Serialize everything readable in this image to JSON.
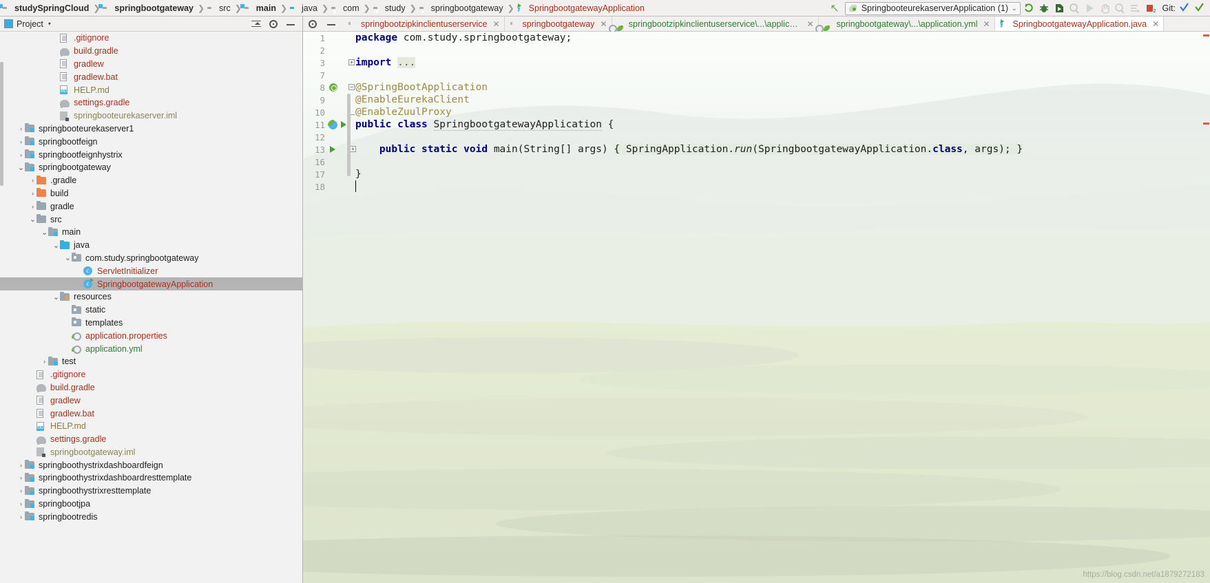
{
  "navbar": {
    "breadcrumbs": [
      {
        "label": "studySpringCloud",
        "icon": "module-icon",
        "bold": true
      },
      {
        "label": "springbootgateway",
        "icon": "module-icon",
        "bold": true
      },
      {
        "label": "src",
        "icon": "folder-icon",
        "bold": false
      },
      {
        "label": "main",
        "icon": "source-folder-icon",
        "bold": true
      },
      {
        "label": "java",
        "icon": "java-source-folder-icon",
        "bold": false
      },
      {
        "label": "com",
        "icon": "package-icon",
        "bold": false
      },
      {
        "label": "study",
        "icon": "package-icon",
        "bold": false
      },
      {
        "label": "springbootgateway",
        "icon": "package-icon",
        "bold": false
      },
      {
        "label": "SpringbootgatewayApplication",
        "icon": "spring-class-icon",
        "bold": false
      }
    ],
    "back_arrow": "navigate-back-icon",
    "run_config": {
      "label": "SpringbooteurekaserverApplication (1)",
      "icon": "spring-run-config-icon",
      "caret": "⌄"
    },
    "toolbar_buttons": [
      {
        "name": "rerun-icon",
        "glyph": "↻",
        "enabled": true,
        "color": "#4a9e2f"
      },
      {
        "name": "debug-icon",
        "glyph": "⚙",
        "enabled": true,
        "color": "#3c763d"
      },
      {
        "name": "run-with-coverage-icon",
        "glyph": "▶",
        "enabled": true,
        "color": "#2f6b2f"
      },
      {
        "name": "profile-icon",
        "glyph": "▶",
        "enabled": false,
        "color": "#888888"
      },
      {
        "name": "run-icon",
        "glyph": "▶",
        "enabled": false,
        "color": "#8fae8f"
      },
      {
        "name": "stop-icon",
        "glyph": "✋",
        "enabled": false,
        "color": "#999999"
      },
      {
        "name": "attach-debugger-icon",
        "glyph": "▶",
        "enabled": false,
        "color": "#999999"
      },
      {
        "name": "show-console-icon",
        "glyph": "≡",
        "enabled": false,
        "color": "#888888"
      },
      {
        "name": "stop-process-icon",
        "glyph": "■",
        "enabled": true,
        "color": "#d14836",
        "badge": "2"
      }
    ],
    "git_label": "Git:",
    "git_buttons": [
      {
        "name": "update-project-icon",
        "glyph": "✓",
        "color": "#3c78c8"
      },
      {
        "name": "commit-icon",
        "glyph": "✓",
        "color": "#4f9b2f"
      }
    ]
  },
  "sidebar": {
    "header": {
      "title": "Project",
      "caret": "▾",
      "actions": [
        {
          "name": "collapse-all-icon"
        },
        {
          "name": "gear-icon"
        },
        {
          "name": "hide-icon"
        }
      ]
    },
    "tree": [
      {
        "indent": 4,
        "arrow": "",
        "icon": "file-icon",
        "label": ".gitignore",
        "color": "c-red"
      },
      {
        "indent": 4,
        "arrow": "",
        "icon": "gradle-icon",
        "label": "build.gradle",
        "color": "c-red"
      },
      {
        "indent": 4,
        "arrow": "",
        "icon": "file-icon",
        "label": "gradlew",
        "color": "c-red"
      },
      {
        "indent": 4,
        "arrow": "",
        "icon": "file-icon",
        "label": "gradlew.bat",
        "color": "c-red"
      },
      {
        "indent": 4,
        "arrow": "",
        "icon": "markdown-icon",
        "label": "HELP.md",
        "color": "c-brown"
      },
      {
        "indent": 4,
        "arrow": "",
        "icon": "gradle-icon",
        "label": "settings.gradle",
        "color": "c-red"
      },
      {
        "indent": 4,
        "arrow": "",
        "icon": "iml-icon",
        "label": "springbooteurekaserver.iml",
        "color": "c-olive"
      },
      {
        "indent": 1,
        "arrow": "›",
        "icon": "module-icon",
        "label": "springbooteurekaserver1",
        "color": "c-default"
      },
      {
        "indent": 1,
        "arrow": "›",
        "icon": "module-icon",
        "label": "springbootfeign",
        "color": "c-default"
      },
      {
        "indent": 1,
        "arrow": "›",
        "icon": "module-icon",
        "label": "springbootfeignhystrix",
        "color": "c-default"
      },
      {
        "indent": 1,
        "arrow": "⌄",
        "icon": "module-icon",
        "label": "springbootgateway",
        "color": "c-default"
      },
      {
        "indent": 2,
        "arrow": "›",
        "icon": "excluded-folder-icon",
        "label": ".gradle",
        "color": "c-default"
      },
      {
        "indent": 2,
        "arrow": "›",
        "icon": "excluded-folder-icon",
        "label": "build",
        "color": "c-default"
      },
      {
        "indent": 2,
        "arrow": "›",
        "icon": "folder-icon",
        "label": "gradle",
        "color": "c-default"
      },
      {
        "indent": 2,
        "arrow": "⌄",
        "icon": "folder-icon",
        "label": "src",
        "color": "c-default"
      },
      {
        "indent": 3,
        "arrow": "⌄",
        "icon": "source-folder-icon",
        "label": "main",
        "color": "c-default"
      },
      {
        "indent": 4,
        "arrow": "⌄",
        "icon": "java-source-folder-icon",
        "label": "java",
        "color": "c-default"
      },
      {
        "indent": 5,
        "arrow": "⌄",
        "icon": "package-icon",
        "label": "com.study.springbootgateway",
        "color": "c-default"
      },
      {
        "indent": 6,
        "arrow": "",
        "icon": "class-icon",
        "label": "ServletInitializer",
        "color": "c-red"
      },
      {
        "indent": 6,
        "arrow": "",
        "icon": "spring-class-icon",
        "label": "SpringbootgatewayApplication",
        "color": "c-red",
        "selected": true
      },
      {
        "indent": 4,
        "arrow": "⌄",
        "icon": "resources-folder-icon",
        "label": "resources",
        "color": "c-default"
      },
      {
        "indent": 5,
        "arrow": "",
        "icon": "package-icon",
        "label": "static",
        "color": "c-default"
      },
      {
        "indent": 5,
        "arrow": "",
        "icon": "package-icon",
        "label": "templates",
        "color": "c-default"
      },
      {
        "indent": 5,
        "arrow": "",
        "icon": "spring-config-icon",
        "label": "application.properties",
        "color": "c-red"
      },
      {
        "indent": 5,
        "arrow": "",
        "icon": "spring-config-icon",
        "label": "application.yml",
        "color": "c-green"
      },
      {
        "indent": 3,
        "arrow": "›",
        "icon": "test-source-folder-icon",
        "label": "test",
        "color": "c-default"
      },
      {
        "indent": 2,
        "arrow": "",
        "icon": "file-icon",
        "label": ".gitignore",
        "color": "c-red"
      },
      {
        "indent": 2,
        "arrow": "",
        "icon": "gradle-icon",
        "label": "build.gradle",
        "color": "c-red"
      },
      {
        "indent": 2,
        "arrow": "",
        "icon": "file-icon",
        "label": "gradlew",
        "color": "c-red"
      },
      {
        "indent": 2,
        "arrow": "",
        "icon": "file-icon",
        "label": "gradlew.bat",
        "color": "c-red"
      },
      {
        "indent": 2,
        "arrow": "",
        "icon": "markdown-icon",
        "label": "HELP.md",
        "color": "c-brown"
      },
      {
        "indent": 2,
        "arrow": "",
        "icon": "gradle-icon",
        "label": "settings.gradle",
        "color": "c-red"
      },
      {
        "indent": 2,
        "arrow": "",
        "icon": "iml-icon",
        "label": "springbootgateway.iml",
        "color": "c-olive"
      },
      {
        "indent": 1,
        "arrow": "›",
        "icon": "module-icon",
        "label": "springboothystrixdashboardfeign",
        "color": "c-default"
      },
      {
        "indent": 1,
        "arrow": "›",
        "icon": "module-icon",
        "label": "springboothystrixdashboardresttemplate",
        "color": "c-default"
      },
      {
        "indent": 1,
        "arrow": "›",
        "icon": "module-icon",
        "label": "springboothystrixresttemplate",
        "color": "c-default"
      },
      {
        "indent": 1,
        "arrow": "›",
        "icon": "module-icon",
        "label": "springbootjpa",
        "color": "c-default"
      },
      {
        "indent": 1,
        "arrow": "›",
        "icon": "module-icon",
        "label": "springbootredis",
        "color": "c-default"
      }
    ]
  },
  "editor": {
    "tools": [
      {
        "name": "settings-gear-icon"
      },
      {
        "name": "hide-editor-icon"
      }
    ],
    "tabs": [
      {
        "label": "springbootzipkinclientuserservice",
        "icon": "gradle-icon",
        "color": "#a8301a",
        "active": false,
        "closable": true
      },
      {
        "label": "springbootgateway",
        "icon": "gradle-icon",
        "color": "#a8301a",
        "active": false,
        "closable": true
      },
      {
        "label": "springbootzipkinclientuserservice\\...\\application.yml",
        "icon": "spring-config-icon",
        "color": "#2e7d32",
        "active": false,
        "closable": true
      },
      {
        "label": "springbootgateway\\...\\application.yml",
        "icon": "spring-config-icon",
        "color": "#2e7d32",
        "active": false,
        "closable": true
      },
      {
        "label": "SpringbootgatewayApplication.java",
        "icon": "spring-class-icon",
        "color": "#a8301a",
        "active": true,
        "closable": true
      }
    ],
    "line_numbers": [
      "1",
      "2",
      "3",
      "7",
      "8",
      "9",
      "10",
      "11",
      "12",
      "13",
      "16",
      "17",
      "18"
    ],
    "code_lines": [
      {
        "n": "1",
        "segments": [
          {
            "t": "package",
            "c": "kw"
          },
          {
            "t": " com.study.springbootgateway;",
            "c": "ident"
          }
        ]
      },
      {
        "n": "2",
        "segments": []
      },
      {
        "n": "3",
        "segments": [
          {
            "t": "import",
            "c": "kw"
          },
          {
            "t": " ",
            "c": "ident"
          },
          {
            "t": "...",
            "c": "dots"
          }
        ],
        "fold": "collapsed"
      },
      {
        "n": "7",
        "segments": []
      },
      {
        "n": "8",
        "segments": [
          {
            "t": "@SpringBootApplication",
            "c": "anno"
          }
        ],
        "gutter_icon": "spring-bean-icon",
        "fold": "start"
      },
      {
        "n": "9",
        "segments": [
          {
            "t": "@EnableEurekaClient",
            "c": "anno"
          }
        ]
      },
      {
        "n": "10",
        "segments": [
          {
            "t": "@EnableZuulProxy",
            "c": "anno"
          }
        ],
        "fold": "end"
      },
      {
        "n": "11",
        "segments": [
          {
            "t": "public",
            "c": "kw"
          },
          {
            "t": " ",
            "c": "ident"
          },
          {
            "t": "class",
            "c": "kw"
          },
          {
            "t": " ",
            "c": "ident"
          },
          {
            "t": "SpringbootgatewayApplication",
            "c": "ident-underline"
          },
          {
            "t": " {",
            "c": "ident"
          }
        ],
        "gutter_icon": "spring-class-run-icon",
        "gutter_run": true
      },
      {
        "n": "12",
        "segments": []
      },
      {
        "n": "13",
        "segments": [
          {
            "t": "    ",
            "c": "ident"
          },
          {
            "t": "public",
            "c": "kw"
          },
          {
            "t": " ",
            "c": "ident"
          },
          {
            "t": "static",
            "c": "kw"
          },
          {
            "t": " ",
            "c": "ident"
          },
          {
            "t": "void",
            "c": "kw"
          },
          {
            "t": " main(String[] args) ",
            "c": "ident"
          },
          {
            "t": "{ ",
            "c": "hl"
          },
          {
            "t": "SpringApplication.",
            "c": "hl"
          },
          {
            "t": "run",
            "c": "hl-italic"
          },
          {
            "t": "(SpringbootgatewayApplication.",
            "c": "hl"
          },
          {
            "t": "class",
            "c": "hl-kw"
          },
          {
            "t": ", args); }",
            "c": "hl"
          }
        ],
        "gutter_run": true,
        "fold": "collapsed-method"
      },
      {
        "n": "16",
        "segments": []
      },
      {
        "n": "17",
        "segments": [
          {
            "t": "}",
            "c": "ident"
          }
        ]
      },
      {
        "n": "18",
        "segments": [],
        "caret": true
      }
    ]
  },
  "watermark": "https://blog.csdn.net/a1879272183",
  "colors": {
    "accent_blue": "#35aee2",
    "spring_green": "#6db33f",
    "keyword_navy": "#000080",
    "annotation_olive": "#9e8c3d",
    "file_red": "#a8301a",
    "selection_gray": "#b4b4b4"
  }
}
